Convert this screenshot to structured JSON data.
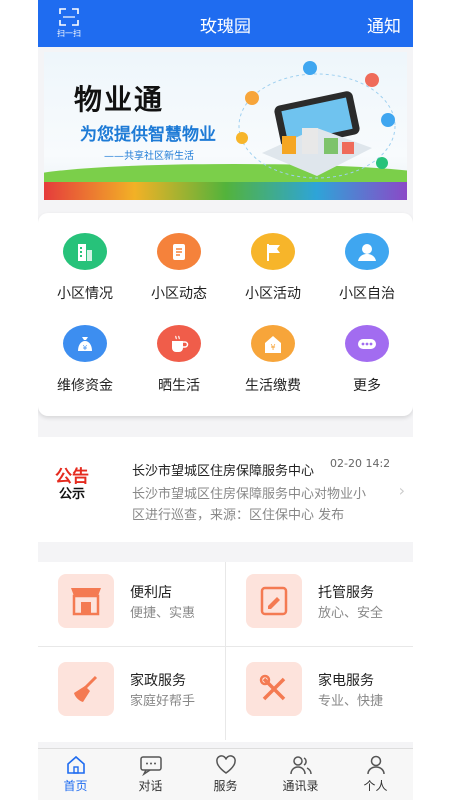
{
  "header": {
    "title": "玫瑰园",
    "scan_label": "扫一扫",
    "notify_label": "通知",
    "bg_color": "#1f6cf0"
  },
  "banner": {
    "title": "物业通",
    "subtitle": "为您提供智慧物业",
    "tagline": "——共享社区新生活"
  },
  "menu": {
    "items": [
      {
        "label": "小区情况",
        "icon": "building-icon",
        "color": "#27c27a"
      },
      {
        "label": "小区动态",
        "icon": "document-icon",
        "color": "#f5823b"
      },
      {
        "label": "小区活动",
        "icon": "flag-icon",
        "color": "#f7b52a"
      },
      {
        "label": "小区自治",
        "icon": "person-icon",
        "color": "#3fa6f0"
      },
      {
        "label": "维修资金",
        "icon": "money-bag-icon",
        "color": "#3d8ef0"
      },
      {
        "label": "晒生活",
        "icon": "coffee-cup-icon",
        "color": "#f05d4a"
      },
      {
        "label": "生活缴费",
        "icon": "payment-house-icon",
        "color": "#f7a53a"
      },
      {
        "label": "更多",
        "icon": "more-icon",
        "color": "#a26cf0"
      }
    ]
  },
  "notice": {
    "badge_top": "公告",
    "badge_bottom": "公示",
    "title": "长沙市望城区住房保障服务中心",
    "date": "02-20 14:2",
    "body": "长沙市望城区住房保障服务中心对物业小区进行巡查，来源：区住保中心 发布"
  },
  "services": [
    {
      "title": "便利店",
      "subtitle": "便捷、实惠",
      "icon": "store-icon"
    },
    {
      "title": "托管服务",
      "subtitle": "放心、安全",
      "icon": "book-icon"
    },
    {
      "title": "家政服务",
      "subtitle": "家庭好帮手",
      "icon": "broom-icon"
    },
    {
      "title": "家电服务",
      "subtitle": "专业、快捷",
      "icon": "tools-icon"
    }
  ],
  "tabs": [
    {
      "label": "首页",
      "icon": "home-icon",
      "active": true
    },
    {
      "label": "对话",
      "icon": "chat-icon",
      "active": false
    },
    {
      "label": "服务",
      "icon": "heart-icon",
      "active": false
    },
    {
      "label": "通讯录",
      "icon": "contacts-icon",
      "active": false
    },
    {
      "label": "个人",
      "icon": "user-icon",
      "active": false
    }
  ]
}
